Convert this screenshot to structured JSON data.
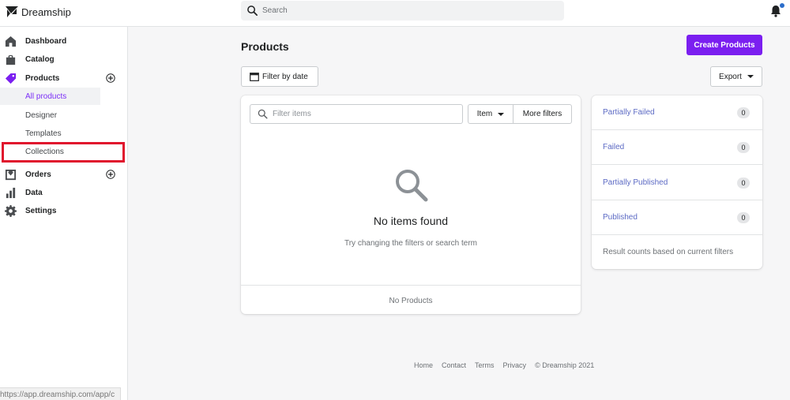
{
  "brand": {
    "name": "Dreamship"
  },
  "search": {
    "placeholder": "Search"
  },
  "sidebar": {
    "items": [
      {
        "label": "Dashboard"
      },
      {
        "label": "Catalog"
      },
      {
        "label": "Products"
      },
      {
        "label": "Orders"
      },
      {
        "label": "Data"
      },
      {
        "label": "Settings"
      }
    ],
    "products_sub": [
      {
        "label": "All products"
      },
      {
        "label": "Designer"
      },
      {
        "label": "Templates"
      },
      {
        "label": "Collections"
      }
    ]
  },
  "status_bar": {
    "url": "https://app.dreamship.com/app/c"
  },
  "main": {
    "title": "Products",
    "create_label": "Create Products",
    "filter_date_label": "Filter by date",
    "export_label": "Export",
    "filter_placeholder": "Filter items",
    "item_label": "Item",
    "more_filters_label": "More filters",
    "empty_title": "No items found",
    "empty_subtitle": "Try changing the filters or search term",
    "footer_text": "No Products"
  },
  "status_panel": {
    "rows": [
      {
        "label": "Partially Failed",
        "count": "0"
      },
      {
        "label": "Failed",
        "count": "0"
      },
      {
        "label": "Partially Published",
        "count": "0"
      },
      {
        "label": "Published",
        "count": "0"
      }
    ],
    "note": "Result counts based on current filters"
  },
  "footer": {
    "links": [
      "Home",
      "Contact",
      "Terms",
      "Privacy"
    ],
    "copyright": "© Dreamship 2021"
  },
  "colors": {
    "accent": "#7b1ff0",
    "link": "#5c6ac4",
    "highlight": "#e0142d",
    "notification": "#2c6ecb"
  }
}
